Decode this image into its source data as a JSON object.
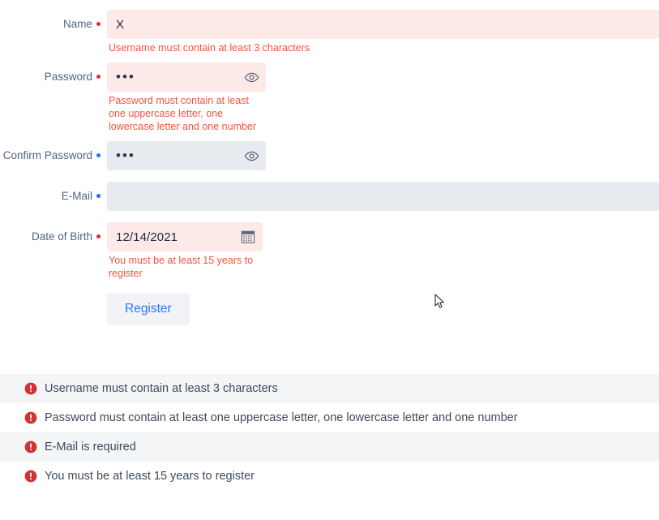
{
  "form": {
    "fields": [
      {
        "label": "Name",
        "required_dot": "red",
        "value": "X",
        "placeholder": "",
        "error": "Username must contain at least 3 characters",
        "state": "error"
      },
      {
        "label": "Password",
        "required_dot": "red",
        "value": "•••",
        "placeholder": "",
        "error": "Password must contain at least one uppercase letter, one lowercase letter and one number",
        "state": "error",
        "adornment": "eye-icon"
      },
      {
        "label": "Confirm Password",
        "required_dot": "blue",
        "value": "•••",
        "placeholder": "",
        "error": "",
        "state": "normal",
        "adornment": "eye-icon"
      },
      {
        "label": "E-Mail",
        "required_dot": "blue",
        "value": "",
        "placeholder": "",
        "error": "",
        "state": "normal"
      },
      {
        "label": "Date of Birth",
        "required_dot": "red",
        "value": "12/14/2021",
        "placeholder": "",
        "error": "You must be at least 15 years to register",
        "state": "error",
        "adornment": "calendar-icon"
      }
    ],
    "submit_label": "Register"
  },
  "summary": {
    "icon": "error-circle-icon",
    "errors": [
      "Username must contain at least 3 characters",
      "Password must contain at least one uppercase letter, one lowercase letter and one number",
      "E-Mail is required",
      "You must be at least 15 years to register"
    ]
  },
  "colors": {
    "error_text": "#f2553d",
    "error_field_bg": "#fde9e8",
    "field_bg": "#e7eaef",
    "required_red": "#e8293d",
    "required_blue": "#1a73ff",
    "button_text": "#2979ff",
    "button_bg": "#f1f3f6",
    "summary_icon": "#d03333",
    "summary_alt_row": "#f4f5f7"
  }
}
